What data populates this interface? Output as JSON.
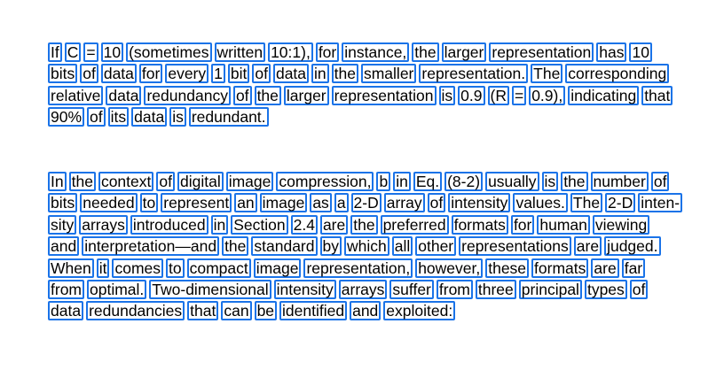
{
  "paragraphs": [
    {
      "lines": [
        [
          "If",
          "C",
          "=",
          "10",
          "(sometimes",
          "written",
          "10:1),",
          "for",
          "instance,",
          "the",
          "larger",
          "representation",
          "has",
          "10"
        ],
        [
          "bits",
          "of",
          "data",
          "for",
          "every",
          "1",
          "bit",
          "of",
          "data",
          "in",
          "the",
          "smaller",
          "representation.",
          "The",
          "corresponding"
        ],
        [
          "relative",
          "data",
          "redundancy",
          "of",
          "the",
          "larger",
          "representation",
          "is",
          "0.9",
          "(R",
          "=",
          "0.9),",
          "indicating",
          "that"
        ],
        [
          "90%",
          "of",
          "its",
          "data",
          "is",
          "redundant."
        ]
      ]
    },
    {
      "lines": [
        [
          "In",
          "the",
          "context",
          "of",
          "digital",
          "image",
          "compression,",
          "b",
          "in",
          "Eq.",
          "(8-2)",
          "usually",
          "is",
          "the",
          "number",
          "of"
        ],
        [
          "bits",
          "needed",
          "to",
          "represent",
          "an",
          "image",
          "as",
          "a",
          "2-D",
          "array",
          "of",
          "intensity",
          "values.",
          "The",
          "2-D",
          "inten-"
        ],
        [
          "sity",
          "arrays",
          "introduced",
          "in",
          "Section",
          "2.4",
          "are",
          "the",
          "preferred",
          "formats",
          "for",
          "human",
          "viewing"
        ],
        [
          "and",
          "interpretation—and",
          "the",
          "standard",
          "by",
          "which",
          "all",
          "other",
          "representations",
          "are",
          "judged."
        ],
        [
          "When",
          "it",
          "comes",
          "to",
          "compact",
          "image",
          "representation,",
          "however,",
          "these",
          "formats",
          "are",
          "far"
        ],
        [
          "from",
          "optimal.",
          "Two-dimensional",
          "intensity",
          "arrays",
          "suffer",
          "from",
          "three",
          "principal",
          "types",
          "of"
        ],
        [
          "data",
          "redundancies",
          "that",
          "can",
          "be",
          "identified",
          "and",
          "exploited:"
        ]
      ]
    }
  ],
  "colors": {
    "word_box_border": "#1a73e8",
    "text": "#000000",
    "background": "#ffffff"
  }
}
